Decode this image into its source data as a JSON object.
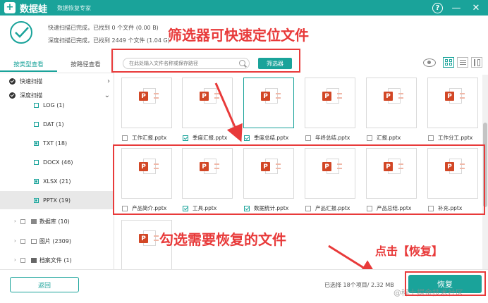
{
  "titlebar": {
    "logo_glyph": "+",
    "app_name": "数据蛙",
    "subtitle": "数据恢复专家",
    "help_glyph": "?",
    "minimize_glyph": "—",
    "close_glyph": "✕"
  },
  "status": {
    "line1": "快速扫描已完成，已找到 0 个文件 (0.00  B)",
    "line2": "深度扫描已完成，已找到 2449 个文件 (1.04 G)"
  },
  "annotations": {
    "filter_hint": "筛选器可快速定位文件",
    "select_hint": "勾选需要恢复的文件",
    "click_hint": "点击【恢复】"
  },
  "toolbar": {
    "search_placeholder": "在此处输入文件名称或保存路径",
    "filter_label": "筛选器"
  },
  "left_panel": {
    "tabs": [
      {
        "label": "按类型查看",
        "active": true
      },
      {
        "label": "按路径查看",
        "active": false
      }
    ],
    "scans": [
      {
        "label": "快速扫描",
        "chevron": "›"
      },
      {
        "label": "深度扫描",
        "chevron": "⌄"
      }
    ],
    "file_types": [
      {
        "label": "LOG (1)",
        "checked": false
      },
      {
        "label": "DAT (1)",
        "checked": false
      },
      {
        "label": "TXT (18)",
        "checked": true
      },
      {
        "label": "DOCX (46)",
        "checked": false
      },
      {
        "label": "XLSX (21)",
        "checked": true
      },
      {
        "label": "PPTX (19)",
        "checked": true,
        "selected": true
      }
    ],
    "categories": [
      {
        "label": "数据库 (10)"
      },
      {
        "label": "图片 (2309)"
      },
      {
        "label": "档案文件 (1)"
      }
    ]
  },
  "files": [
    {
      "name": "工作汇报.pptx",
      "checked": false,
      "highlighted": false
    },
    {
      "name": "季度汇报.pptx",
      "checked": true,
      "highlighted": false
    },
    {
      "name": "季度总结.pptx",
      "checked": true,
      "highlighted": true
    },
    {
      "name": "年终总结.pptx",
      "checked": false,
      "highlighted": false
    },
    {
      "name": "汇报.pptx",
      "checked": false,
      "highlighted": false
    },
    {
      "name": "工作分工.pptx",
      "checked": false,
      "highlighted": false
    },
    {
      "name": "产品简介.pptx",
      "checked": false,
      "highlighted": false
    },
    {
      "name": "工具.pptx",
      "checked": true,
      "highlighted": false
    },
    {
      "name": "数据统计.pptx",
      "checked": true,
      "highlighted": false
    },
    {
      "name": "产品汇报.pptx",
      "checked": false,
      "highlighted": false
    },
    {
      "name": "产品总结.pptx",
      "checked": false,
      "highlighted": false
    },
    {
      "name": "补充.pptx",
      "checked": false,
      "highlighted": false
    },
    {
      "name": "",
      "checked": false,
      "highlighted": false
    }
  ],
  "file_icon_letter": "P",
  "bottom": {
    "back_label": "返回",
    "selection_info": "已选择 18个项目/ 2.32 MB",
    "recover_label": "恢复",
    "watermark": "@稀土掘金技术社区"
  },
  "colors": {
    "accent": "#1aa39a",
    "annotation": "#e83a3a",
    "ppt_badge": "#d24726"
  }
}
